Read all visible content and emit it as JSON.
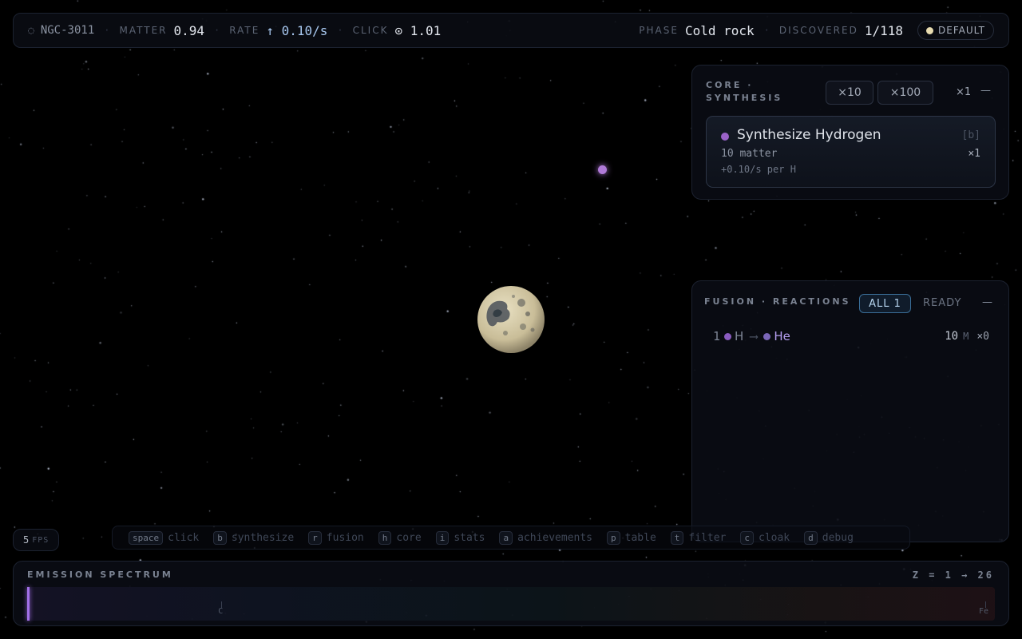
{
  "topbar": {
    "system_name": "NGC-3011",
    "matter_label": "MATTER",
    "matter_value": "0.94",
    "rate_label": "RATE",
    "rate_value": "↑ 0.10/s",
    "click_label": "CLICK",
    "click_value": "⊙ 1.01",
    "phase_label": "PHASE",
    "phase_value": "Cold rock",
    "discovered_label": "DISCOVERED",
    "discovered_value": "1/118",
    "theme_label": "DEFAULT",
    "icon": "galaxy-icon"
  },
  "core_panel": {
    "title": "CORE · SYNTHESIS",
    "mult10": "×10",
    "mult100": "×100",
    "current_mult": "×1",
    "collapse": "—",
    "card": {
      "title": "Synthesize Hydrogen",
      "key": "[b]",
      "cost": "10 matter",
      "count": "×1",
      "rate": "+0.10/s per H",
      "dot_color": "#9a62c8"
    }
  },
  "fusion_panel": {
    "title": "FUSION · REACTIONS",
    "tab_all": "ALL 1",
    "tab_ready": "READY",
    "collapse": "—",
    "reactions": [
      {
        "num": "1",
        "input": "H",
        "arrow": "⟶",
        "output": "He",
        "cost": "10",
        "unit": "M",
        "count": "×0"
      }
    ]
  },
  "fps": {
    "value": "5",
    "label": "FPS"
  },
  "shortcuts": [
    {
      "key": "space",
      "label": "click"
    },
    {
      "key": "b",
      "label": "synthesize"
    },
    {
      "key": "r",
      "label": "fusion"
    },
    {
      "key": "h",
      "label": "core"
    },
    {
      "key": "i",
      "label": "stats"
    },
    {
      "key": "a",
      "label": "achievements"
    },
    {
      "key": "p",
      "label": "table"
    },
    {
      "key": "t",
      "label": "filter"
    },
    {
      "key": "c",
      "label": "cloak"
    },
    {
      "key": "d",
      "label": "debug"
    }
  ],
  "spectrum": {
    "title": "EMISSION SPECTRUM",
    "range": "Z = 1 → 26",
    "ticks": [
      {
        "label": "C",
        "z": 6
      },
      {
        "label": "Fe",
        "z": 26
      }
    ],
    "lines": [
      {
        "z": 1,
        "color": "#a270e8"
      }
    ]
  },
  "colors": {
    "accent": "#3a6e98",
    "hydrogen": "#9a62c8",
    "helium": "#b59ef0"
  }
}
